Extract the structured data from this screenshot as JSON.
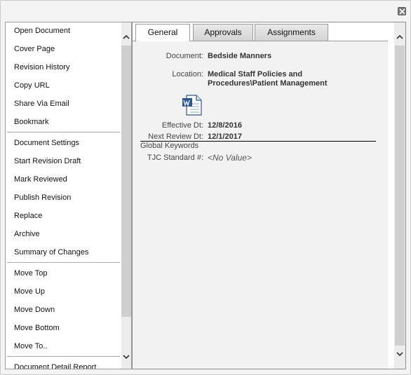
{
  "menu": {
    "items": [
      {
        "label": "Open Document"
      },
      {
        "label": "Cover Page"
      },
      {
        "label": "Revision History"
      },
      {
        "label": "Copy URL"
      },
      {
        "label": "Share Via Email"
      },
      {
        "label": "Bookmark"
      },
      {
        "label": "Document Settings"
      },
      {
        "label": "Start Revision Draft"
      },
      {
        "label": "Mark Reviewed"
      },
      {
        "label": "Publish Revision"
      },
      {
        "label": "Replace"
      },
      {
        "label": "Archive"
      },
      {
        "label": "Summary of Changes"
      },
      {
        "label": "Move Top"
      },
      {
        "label": "Move Up"
      },
      {
        "label": "Move Down"
      },
      {
        "label": "Move Bottom"
      },
      {
        "label": "Move To.."
      },
      {
        "label": "Document Detail Report"
      }
    ]
  },
  "tabs": [
    {
      "label": "General",
      "active": true
    },
    {
      "label": "Approvals",
      "active": false
    },
    {
      "label": "Assignments",
      "active": false
    }
  ],
  "general": {
    "document_label": "Document:",
    "document_value": "Bedside Manners",
    "location_label": "Location:",
    "location_value": "Medical Staff Policies and Procedures\\Patient Management",
    "file_icon": "word-document-icon",
    "effective_label": "Effective Dt:",
    "effective_value": "12/8/2016",
    "next_review_label": "Next Review Dt:",
    "next_review_value": "12/1/2017",
    "section_title": "Global Keywords",
    "tjc_label": "TJC Standard #:",
    "tjc_value": "<No Value>"
  },
  "colors": {
    "accent_word_blue": "#2b5797",
    "panel_background": "#f2f2f2"
  }
}
